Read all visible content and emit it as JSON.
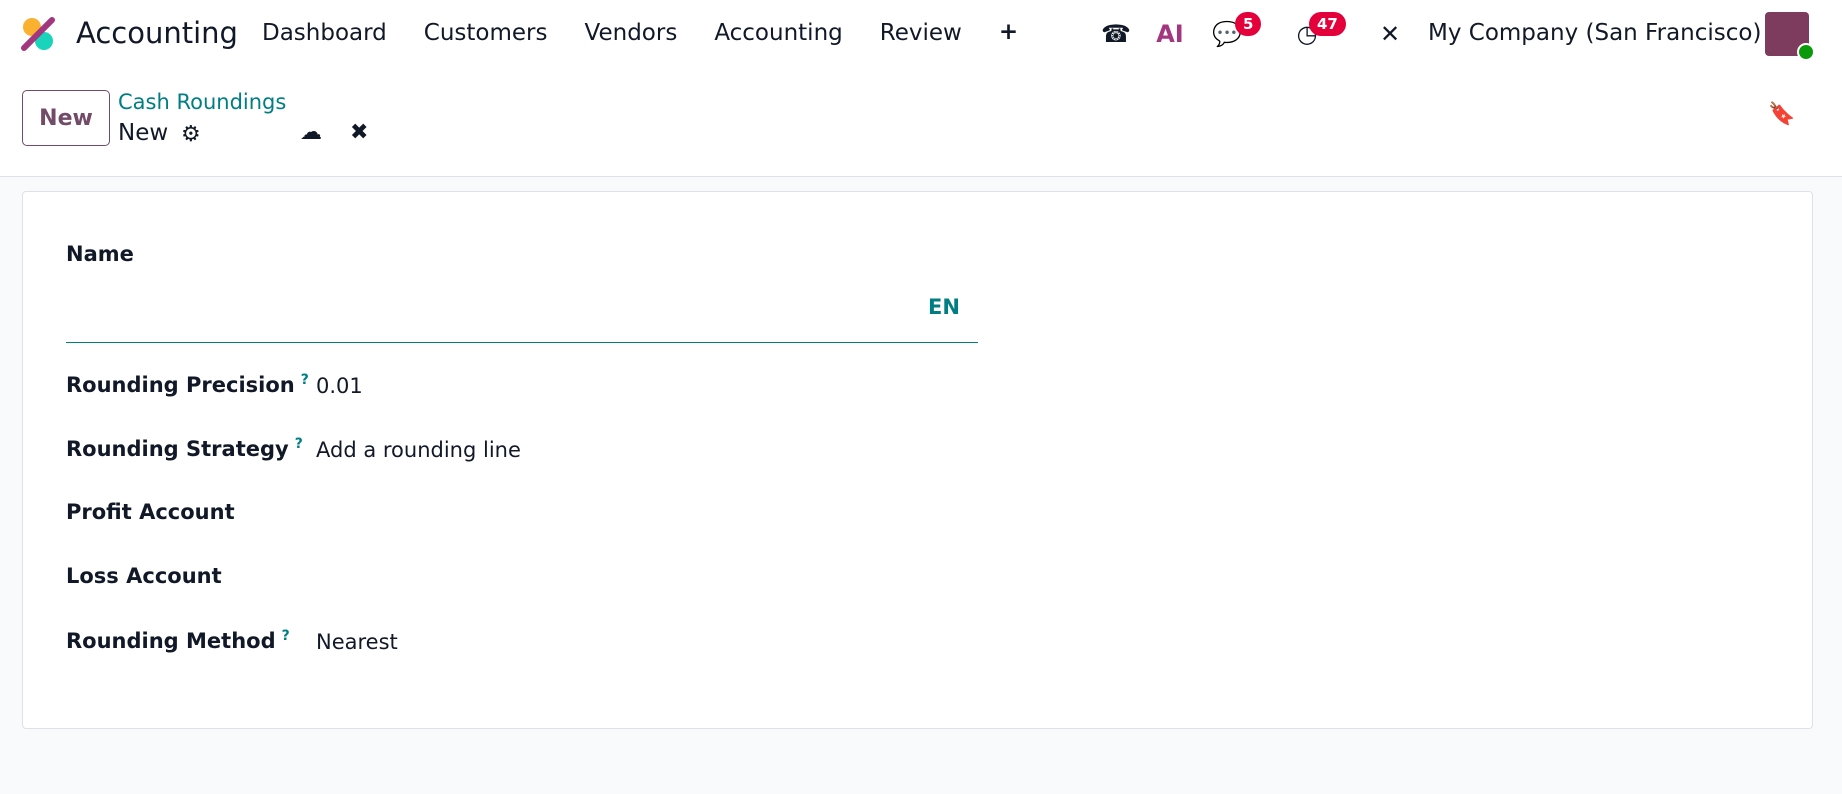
{
  "topbar": {
    "app_name": "Accounting",
    "nav": [
      "Dashboard",
      "Customers",
      "Vendors",
      "Accounting",
      "Review"
    ],
    "add_label": "+",
    "chat_badge": "5",
    "activity_badge": "47",
    "ai_label": "AI",
    "company": "My Company (San Francisco)"
  },
  "control": {
    "new_label": "New",
    "breadcrumb": "Cash Roundings",
    "record": "New"
  },
  "form": {
    "name_label": "Name",
    "name_value": "",
    "lang": "EN",
    "fields": [
      {
        "label": "Rounding Precision",
        "help": "?",
        "value": "0.01"
      },
      {
        "label": "Rounding Strategy",
        "help": "?",
        "value": "Add a rounding line"
      },
      {
        "label": "Profit Account",
        "help": "",
        "value": ""
      },
      {
        "label": "Loss Account",
        "help": "",
        "value": ""
      },
      {
        "label": "Rounding Method",
        "help": "?",
        "value": "Nearest"
      }
    ]
  },
  "colors": {
    "brand": "#714b67",
    "teal": "#017e84",
    "badge": "#e4003a"
  }
}
